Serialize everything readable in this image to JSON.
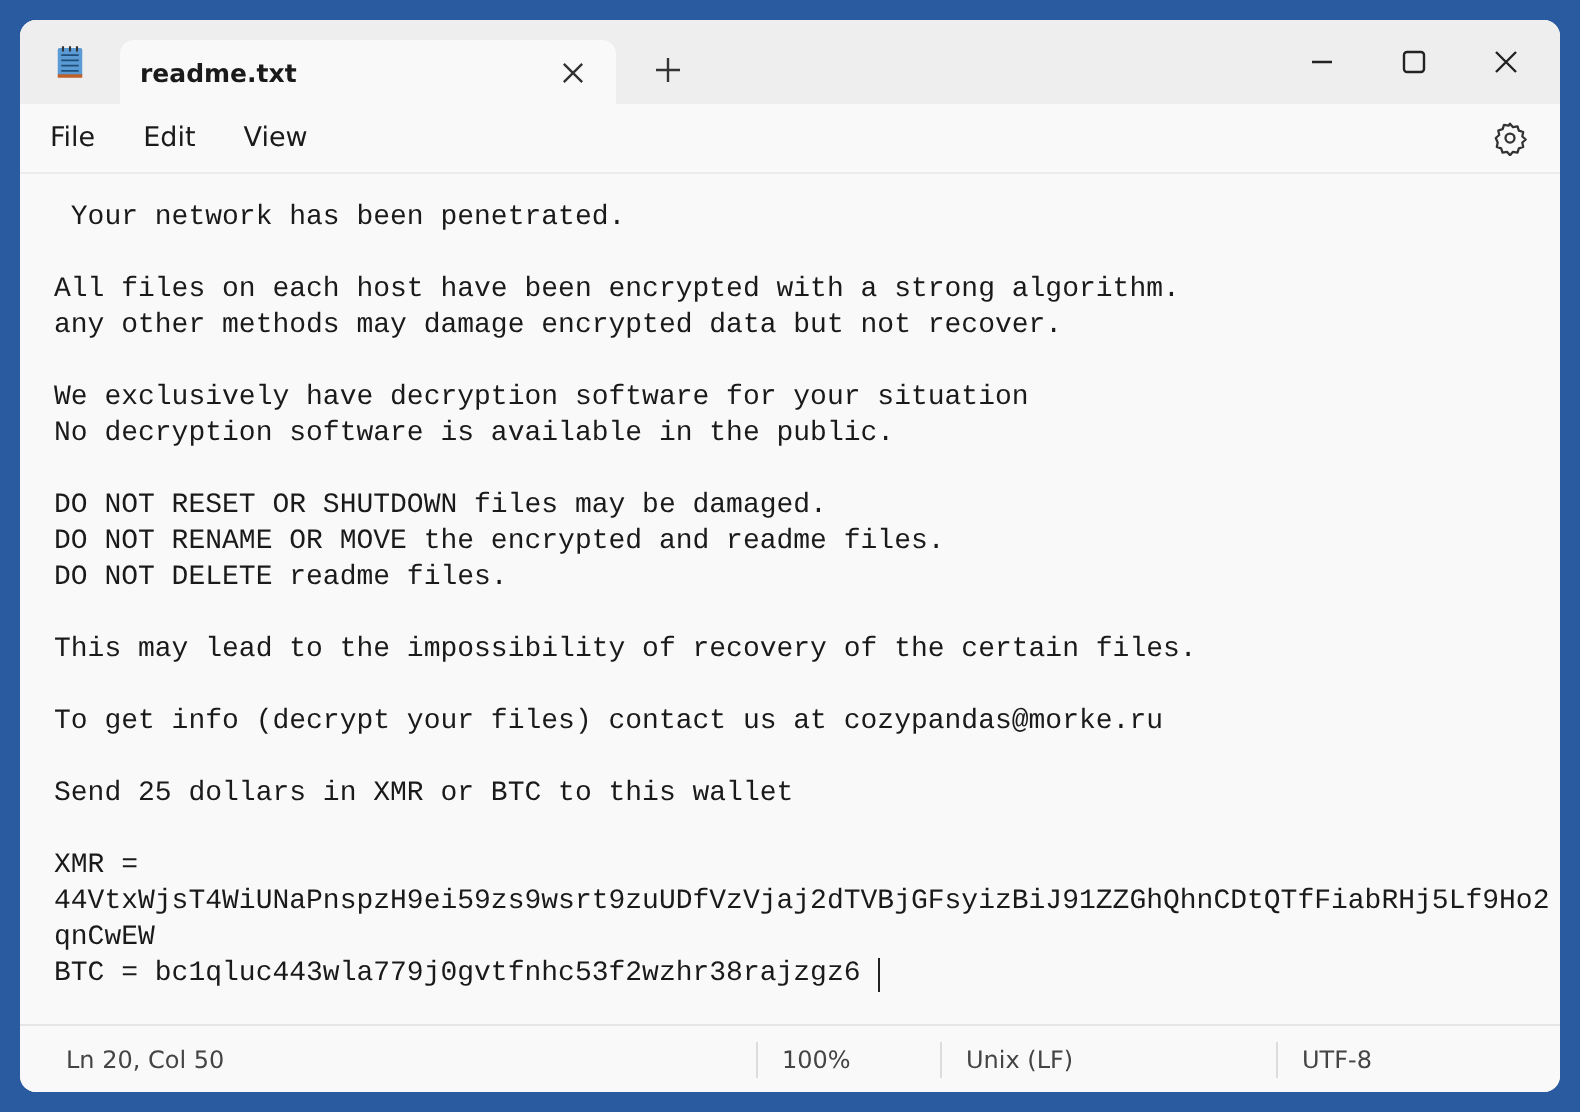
{
  "tabs": [
    {
      "label": "readme.txt",
      "selected": true
    }
  ],
  "menu": [
    "File",
    "Edit",
    "View"
  ],
  "document": {
    "paragraphs": [
      [
        " Your network has been penetrated."
      ],
      [
        "All files on each host have been encrypted with a strong algorithm.",
        "any other methods may damage encrypted data but not recover."
      ],
      [
        "We exclusively have decryption software for your situation",
        "No decryption software is available in the public."
      ],
      [
        "DO NOT RESET OR SHUTDOWN files may be damaged.",
        "DO NOT RENAME OR MOVE the encrypted and readme files.",
        "DO NOT DELETE readme files."
      ],
      [
        "This may lead to the impossibility of recovery of the certain files."
      ],
      [
        "To get info (decrypt your files) contact us at cozypandas@morke.ru"
      ],
      [
        "Send 25 dollars in XMR or BTC to this wallet"
      ],
      [
        "XMR =",
        "44VtxWjsT4WiUNaPnspzH9ei59zs9wsrt9zuUDfVzVjaj2dTVBjGFsyizBiJ91ZZGhQhnCDtQTfFiabRHj5Lf9Ho2",
        "qnCwEW",
        "BTC = bc1qluc443wla779j0gvtfnhc53f2wzhr38rajzgz6 "
      ]
    ]
  },
  "status_bar": {
    "position": "Ln 20, Col 50",
    "zoom": "100%",
    "line_ending": "Unix (LF)",
    "encoding": "UTF-8"
  }
}
